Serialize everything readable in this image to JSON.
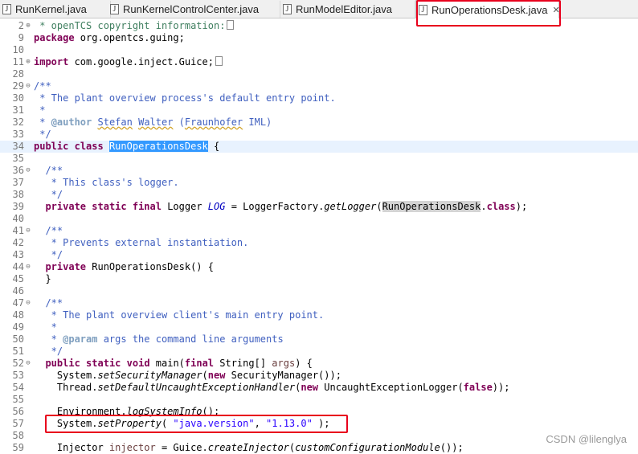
{
  "tabs": [
    {
      "label": "RunKernel.java",
      "active": false
    },
    {
      "label": "RunKernelControlCenter.java",
      "active": false
    },
    {
      "label": "RunModelEditor.java",
      "active": false
    },
    {
      "label": "RunOperationsDesk.java",
      "active": true,
      "close": "✕"
    }
  ],
  "editor": {
    "lines": [
      {
        "n": "2",
        "fold": "⊕",
        "html": "<span class='cm'> * openTCS copyright information:</span><span class='ellip'></span>"
      },
      {
        "n": "9",
        "html": "<span class='kw'>package</span> org.opentcs.guing;"
      },
      {
        "n": "10",
        "html": ""
      },
      {
        "n": "11",
        "fold": "⊕",
        "html": "<span class='kw'>import</span> com.google.inject.Guice;<span class='ellip'></span>"
      },
      {
        "n": "28",
        "html": ""
      },
      {
        "n": "29",
        "fold": "⊖",
        "html": "<span class='jd'>/**</span>"
      },
      {
        "n": "30",
        "html": "<span class='jd'> * The plant overview process's default entry point.</span>"
      },
      {
        "n": "31",
        "html": "<span class='jd'> *</span>"
      },
      {
        "n": "32",
        "html": "<span class='jd'> * </span><span class='tag'>@author</span><span class='jd'> <span class='sq'>Stefan</span> <span class='sq'>Walter</span> (<span class='sq'>Fraunhofer</span> IML)</span>"
      },
      {
        "n": "33",
        "html": "<span class='jd'> */</span>"
      },
      {
        "n": "34",
        "current": true,
        "html": "<span class='kw'>public</span> <span class='kw'>class</span> <span class='sel'>RunOperationsDesk</span> {"
      },
      {
        "n": "35",
        "html": ""
      },
      {
        "n": "36",
        "fold": "⊖",
        "html": "  <span class='jd'>/**</span>"
      },
      {
        "n": "37",
        "html": "<span class='jd'>   * This class's logger.</span>"
      },
      {
        "n": "38",
        "html": "<span class='jd'>   */</span>"
      },
      {
        "n": "39",
        "html": "  <span class='kw'>private</span> <span class='kw'>static</span> <span class='kw'>final</span> Logger <span class='fld'>LOG</span> = LoggerFactory.<span class='it'>getLogger</span>(<span class='occ'>RunOperationsDesk</span>.<span class='kw'>class</span>);"
      },
      {
        "n": "40",
        "html": ""
      },
      {
        "n": "41",
        "fold": "⊖",
        "html": "  <span class='jd'>/**</span>"
      },
      {
        "n": "42",
        "html": "<span class='jd'>   * Prevents external instantiation.</span>"
      },
      {
        "n": "43",
        "html": "<span class='jd'>   */</span>"
      },
      {
        "n": "44",
        "fold": "⊖",
        "html": "  <span class='kw'>private</span> RunOperationsDesk() {"
      },
      {
        "n": "45",
        "html": "  }"
      },
      {
        "n": "46",
        "html": ""
      },
      {
        "n": "47",
        "fold": "⊖",
        "html": "  <span class='jd'>/**</span>"
      },
      {
        "n": "48",
        "html": "<span class='jd'>   * The plant overview client's main entry point.</span>"
      },
      {
        "n": "49",
        "html": "<span class='jd'>   *</span>"
      },
      {
        "n": "50",
        "html": "<span class='jd'>   * </span><span class='tag'>@param</span><span class='jd'> args the command line arguments</span>"
      },
      {
        "n": "51",
        "html": "<span class='jd'>   */</span>"
      },
      {
        "n": "52",
        "fold": "⊖",
        "html": "  <span class='kw'>public</span> <span class='kw'>static</span> <span class='kw'>void</span> main(<span class='kw'>final</span> String[] <span class='var'>args</span>) {"
      },
      {
        "n": "53",
        "html": "    System.<span class='it'>setSecurityManager</span>(<span class='kw'>new</span> SecurityManager());"
      },
      {
        "n": "54",
        "html": "    Thread.<span class='it'>setDefaultUncaughtExceptionHandler</span>(<span class='kw'>new</span> UncaughtExceptionLogger(<span class='kw'>false</span>));"
      },
      {
        "n": "55",
        "html": ""
      },
      {
        "n": "56",
        "html": "    Environment.<span class='it'>logSystemInfo</span>();"
      },
      {
        "n": "57",
        "html": "    System.<span class='it'>setProperty</span>( <span class='str'>\"java.version\"</span>, <span class='str'>\"1.13.0\"</span> );"
      },
      {
        "n": "58",
        "html": ""
      },
      {
        "n": "59",
        "html": "    Injector <span class='var'>injector</span> = Guice.<span class='it'>createInjector</span>(<span class='it'>customConfigurationModule</span>());"
      }
    ]
  },
  "watermark": "CSDN @lilenglya",
  "colors": {
    "highlight": "#e8001c",
    "keyword": "#7f0055",
    "javadoc": "#3f5fbf",
    "string": "#2a00ff",
    "selection": "#3399ff"
  }
}
